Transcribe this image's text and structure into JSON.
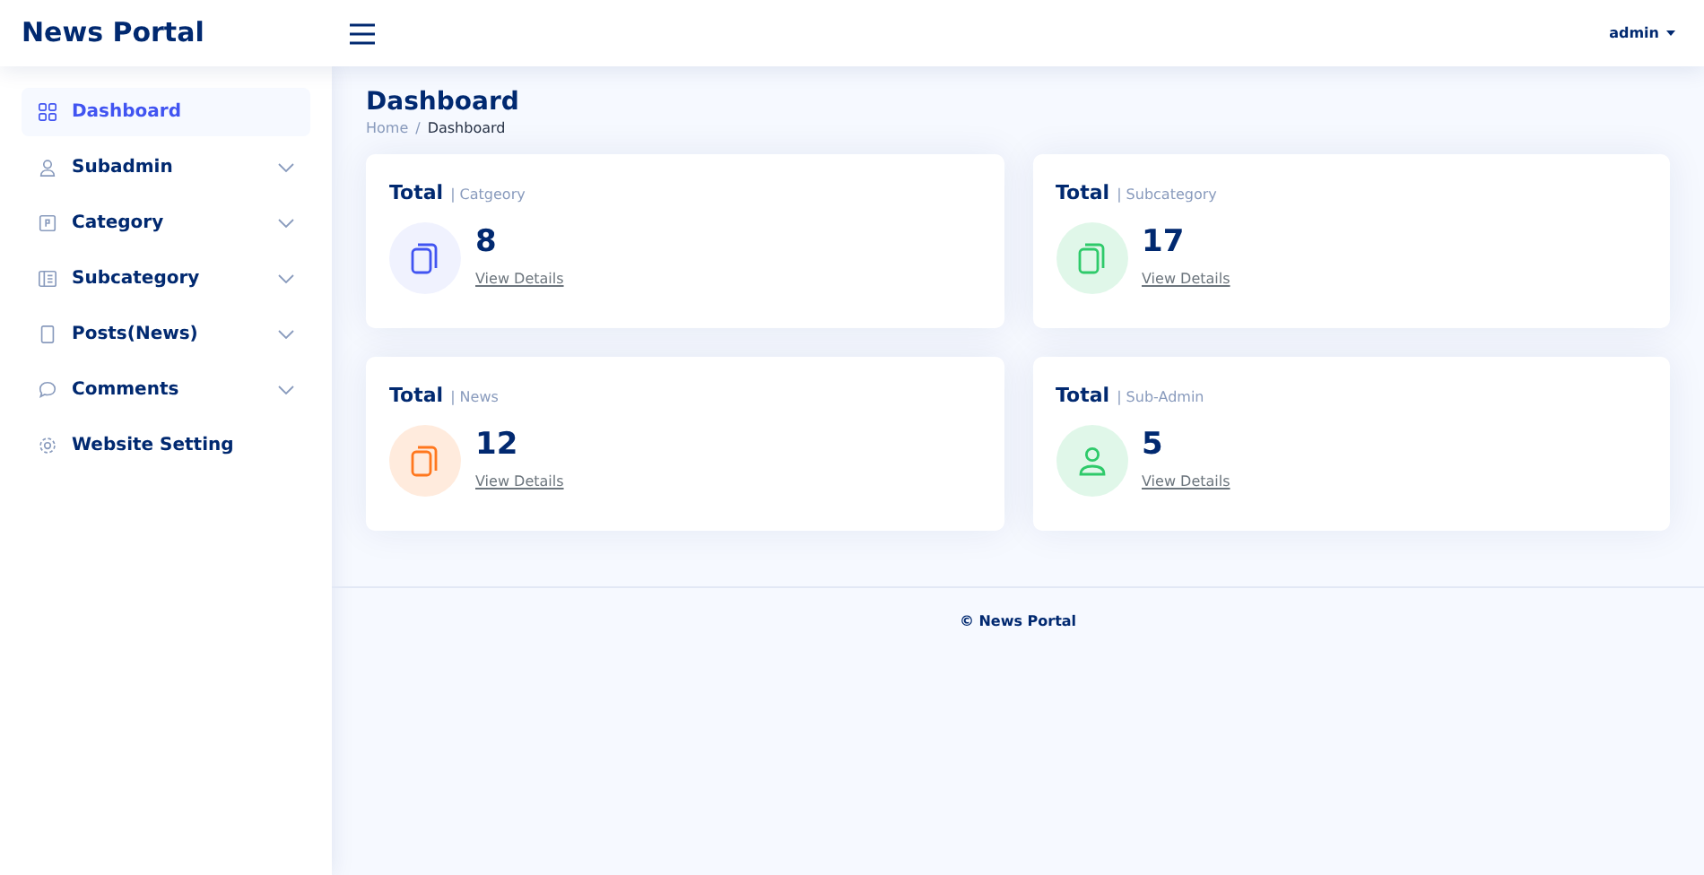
{
  "header": {
    "brand": "News Portal",
    "user": "admin"
  },
  "sidebar": {
    "items": [
      {
        "label": "Dashboard",
        "selected": true,
        "expandable": false
      },
      {
        "label": "Subadmin",
        "selected": false,
        "expandable": true
      },
      {
        "label": "Category",
        "selected": false,
        "expandable": true
      },
      {
        "label": "Subcategory",
        "selected": false,
        "expandable": true
      },
      {
        "label": "Posts(News)",
        "selected": false,
        "expandable": true
      },
      {
        "label": "Comments",
        "selected": false,
        "expandable": true
      },
      {
        "label": "Website Setting",
        "selected": false,
        "expandable": false
      }
    ]
  },
  "page": {
    "title": "Dashboard",
    "breadcrumb": [
      "Home",
      "Dashboard"
    ],
    "separator": "/"
  },
  "cards": [
    {
      "title": "Total",
      "subtitle": "| Catgeory",
      "value": "8",
      "link": "View Details",
      "kind": "pages",
      "color": "#4154f1"
    },
    {
      "title": "Total",
      "subtitle": "| Subcategory",
      "value": "17",
      "link": "View Details",
      "kind": "pages",
      "color": "#2eca6a"
    },
    {
      "title": "Total",
      "subtitle": "| News",
      "value": "12",
      "link": "View Details",
      "kind": "pages",
      "color": "#ff771d"
    },
    {
      "title": "Total",
      "subtitle": "| Sub-Admin",
      "value": "5",
      "link": "View Details",
      "kind": "person",
      "color": "#2eca6a"
    }
  ],
  "footer": {
    "text": "© News Portal"
  }
}
